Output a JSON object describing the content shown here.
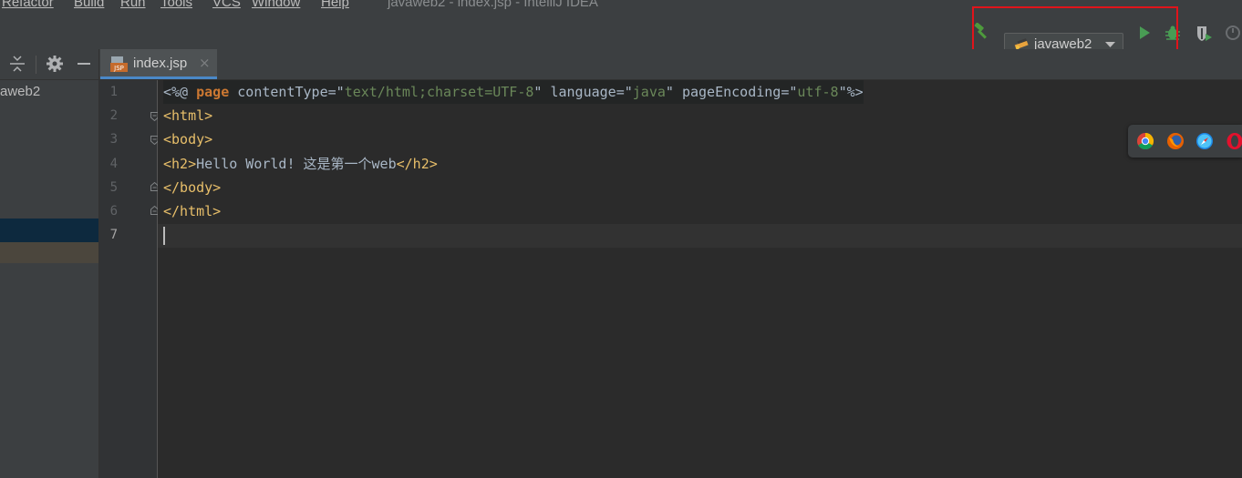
{
  "menubar": {
    "items": [
      "Refactor",
      "Build",
      "Run",
      "Tools",
      "VCS",
      "Window",
      "Help"
    ],
    "window_title": "javaweb2 - index.jsp - IntelliJ IDEA"
  },
  "toolbar": {
    "run_config": "javaweb2",
    "icons": [
      "build-hammer-icon",
      "run-config-icon",
      "chevron-down-icon",
      "run-icon",
      "debug-icon",
      "run-with-coverage-icon",
      "profile-icon"
    ]
  },
  "project_panel": {
    "project_label": "aweb2"
  },
  "editor_tabs": [
    {
      "label": "index.jsp",
      "icon": "jsp-file-icon",
      "close": "×"
    }
  ],
  "editor": {
    "line_numbers": [
      "1",
      "2",
      "3",
      "4",
      "5",
      "6",
      "7"
    ],
    "lines": [
      "<%@ page contentType=\"text/html;charset=UTF-8\" language=\"java\" pageEncoding=\"utf-8\"%>",
      "<html>",
      "<body>",
      "<h2>Hello World! 这是第一个web</h2>",
      "</body>",
      "</html>",
      ""
    ]
  },
  "browser_bar": {
    "icons": [
      "chrome-icon",
      "firefox-icon",
      "safari-icon",
      "opera-icon"
    ]
  },
  "colors": {
    "highlight_box": "#e0141b",
    "tag": "#e8bf6a",
    "keyword": "#cc7832",
    "string": "#6a8759",
    "tab_underline": "#4a88c7"
  }
}
